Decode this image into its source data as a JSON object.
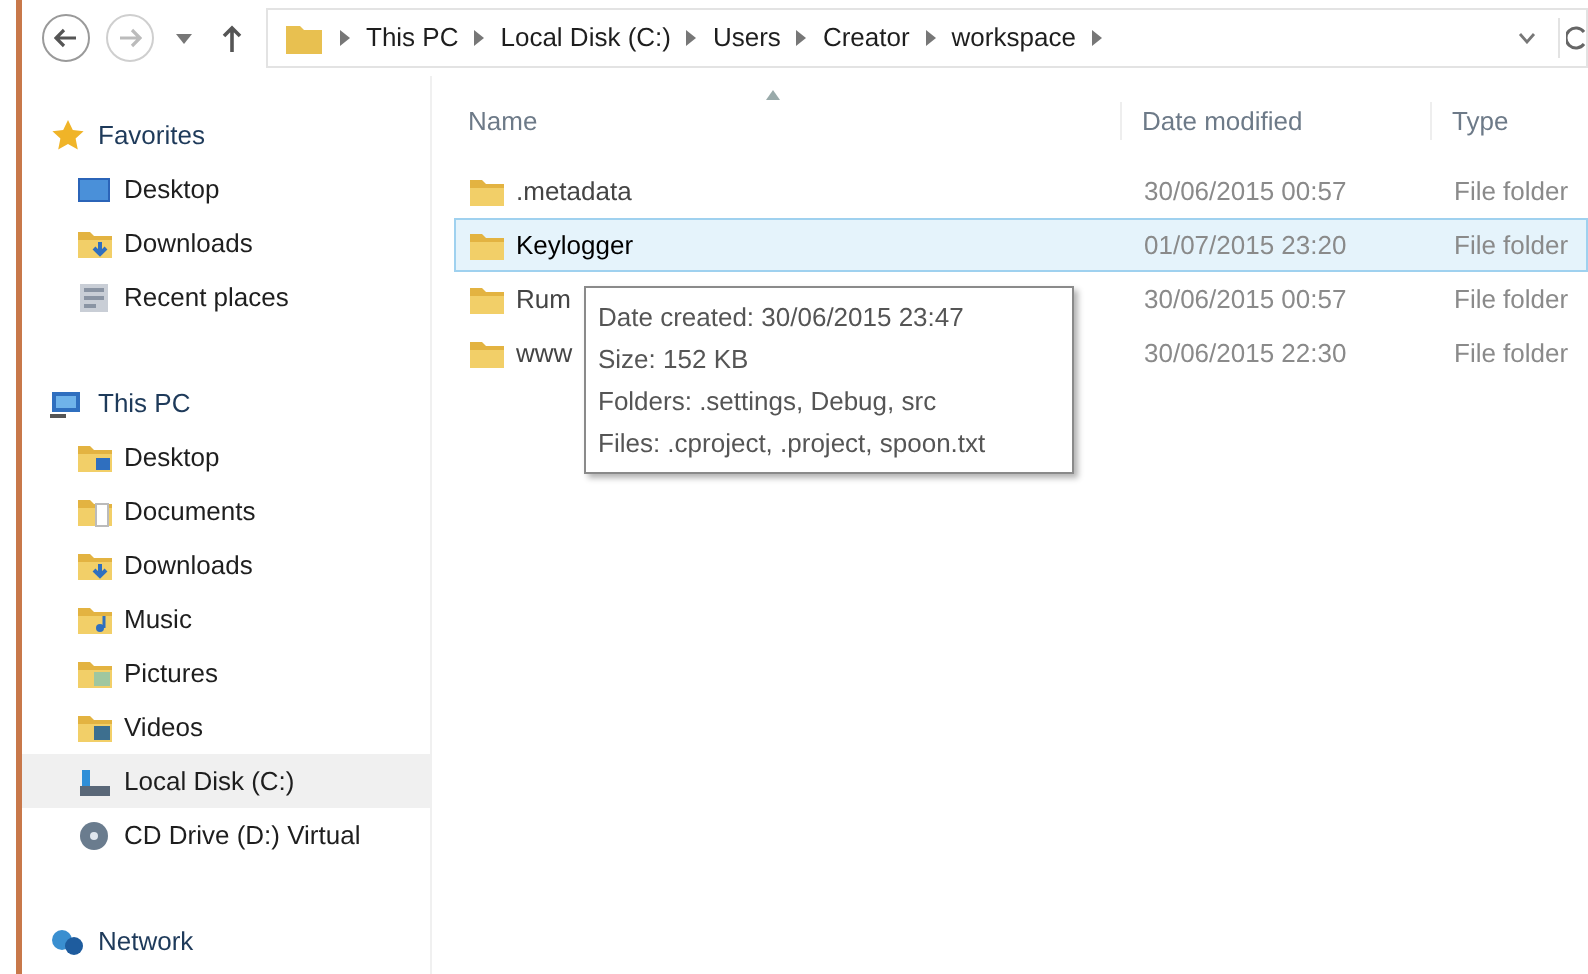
{
  "address_bar": {
    "crumbs": [
      "This PC",
      "Local Disk (C:)",
      "Users",
      "Creator",
      "workspace"
    ]
  },
  "sidebar": {
    "sections": [
      {
        "label": "Favorites",
        "items": [
          {
            "label": "Desktop",
            "selected": false
          },
          {
            "label": "Downloads",
            "selected": false
          },
          {
            "label": "Recent places",
            "selected": false
          }
        ]
      },
      {
        "label": "This PC",
        "items": [
          {
            "label": "Desktop",
            "selected": false
          },
          {
            "label": "Documents",
            "selected": false
          },
          {
            "label": "Downloads",
            "selected": false
          },
          {
            "label": "Music",
            "selected": false
          },
          {
            "label": "Pictures",
            "selected": false
          },
          {
            "label": "Videos",
            "selected": false
          },
          {
            "label": "Local Disk (C:)",
            "selected": true
          },
          {
            "label": "CD Drive (D:) Virtual",
            "selected": false
          }
        ]
      },
      {
        "label": "Network"
      }
    ]
  },
  "table": {
    "columns": [
      "Name",
      "Date modified",
      "Type"
    ],
    "rows": [
      {
        "name": ".metadata",
        "date_modified": "30/06/2015 00:57",
        "type": "File folder",
        "selected": false
      },
      {
        "name": "Keylogger",
        "date_modified": "01/07/2015 23:20",
        "type": "File folder",
        "selected": true
      },
      {
        "name": "Rum",
        "date_modified": "30/06/2015 00:57",
        "type": "File folder",
        "selected": false
      },
      {
        "name": "www",
        "date_modified": "30/06/2015 22:30",
        "type": "File folder",
        "selected": false
      }
    ]
  },
  "tooltip": {
    "lines": [
      "Date created: 30/06/2015 23:47",
      "Size: 152 KB",
      "Folders: .settings, Debug, src",
      "Files: .cproject, .project, spoon.txt"
    ]
  }
}
